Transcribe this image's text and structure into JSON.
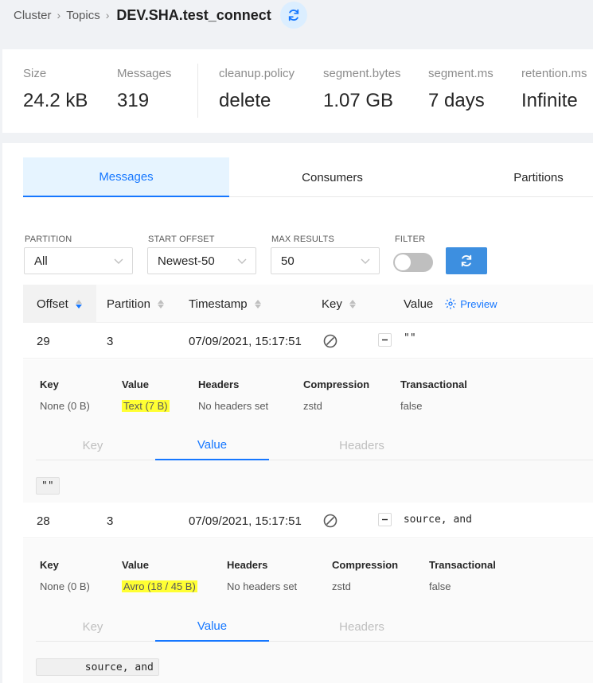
{
  "breadcrumb": {
    "cluster": "Cluster",
    "topics": "Topics",
    "title": "DEV.SHA.test_connect"
  },
  "stats": [
    {
      "label": "Size",
      "value": "24.2 kB"
    },
    {
      "label": "Messages",
      "value": "319"
    },
    {
      "label": "cleanup.policy",
      "value": "delete"
    },
    {
      "label": "segment.bytes",
      "value": "1.07 GB"
    },
    {
      "label": "segment.ms",
      "value": "7 days"
    },
    {
      "label": "retention.ms",
      "value": "Infinite"
    }
  ],
  "tabs": [
    "Messages",
    "Consumers",
    "Partitions"
  ],
  "filters": {
    "partition": {
      "label": "PARTITION",
      "value": "All"
    },
    "start_offset": {
      "label": "START OFFSET",
      "value": "Newest-50"
    },
    "max_results": {
      "label": "MAX RESULTS",
      "value": "50"
    },
    "filter": {
      "label": "FILTER"
    }
  },
  "table": {
    "headers": {
      "offset": "Offset",
      "partition": "Partition",
      "timestamp": "Timestamp",
      "key": "Key",
      "value": "Value",
      "preview": "Preview"
    },
    "rows": [
      {
        "offset": "29",
        "partition": "3",
        "timestamp": "07/09/2021, 15:17:51",
        "value": "\"\"",
        "meta": [
          {
            "k": "Key",
            "v": "None (0 B)"
          },
          {
            "k": "Value",
            "v": "Text (7 B)"
          },
          {
            "k": "Headers",
            "v": "No headers set"
          },
          {
            "k": "Compression",
            "v": "zstd"
          },
          {
            "k": "Transactional",
            "v": "false"
          }
        ],
        "subtabs": [
          "Key",
          "Value",
          "Headers"
        ],
        "code": "\"\""
      },
      {
        "offset": "28",
        "partition": "3",
        "timestamp": "07/09/2021, 15:17:51",
        "value": " source, and",
        "meta": [
          {
            "k": "Key",
            "v": "None (0 B)"
          },
          {
            "k": "Value",
            "v": "Avro (18 / 45 B)"
          },
          {
            "k": "Headers",
            "v": "No headers set"
          },
          {
            "k": "Compression",
            "v": "zstd"
          },
          {
            "k": "Transactional",
            "v": "false"
          }
        ],
        "subtabs": [
          "Key",
          "Value",
          "Headers"
        ],
        "code": "       source, and"
      }
    ]
  },
  "colors": {
    "accent": "#1677ff",
    "button": "#3d8fe0",
    "highlight": "#ffff33"
  },
  "icons": [
    "sync-icon",
    "chevron-down-icon",
    "sort-icon",
    "gear-icon",
    "null-key-icon",
    "collapse-icon"
  ]
}
